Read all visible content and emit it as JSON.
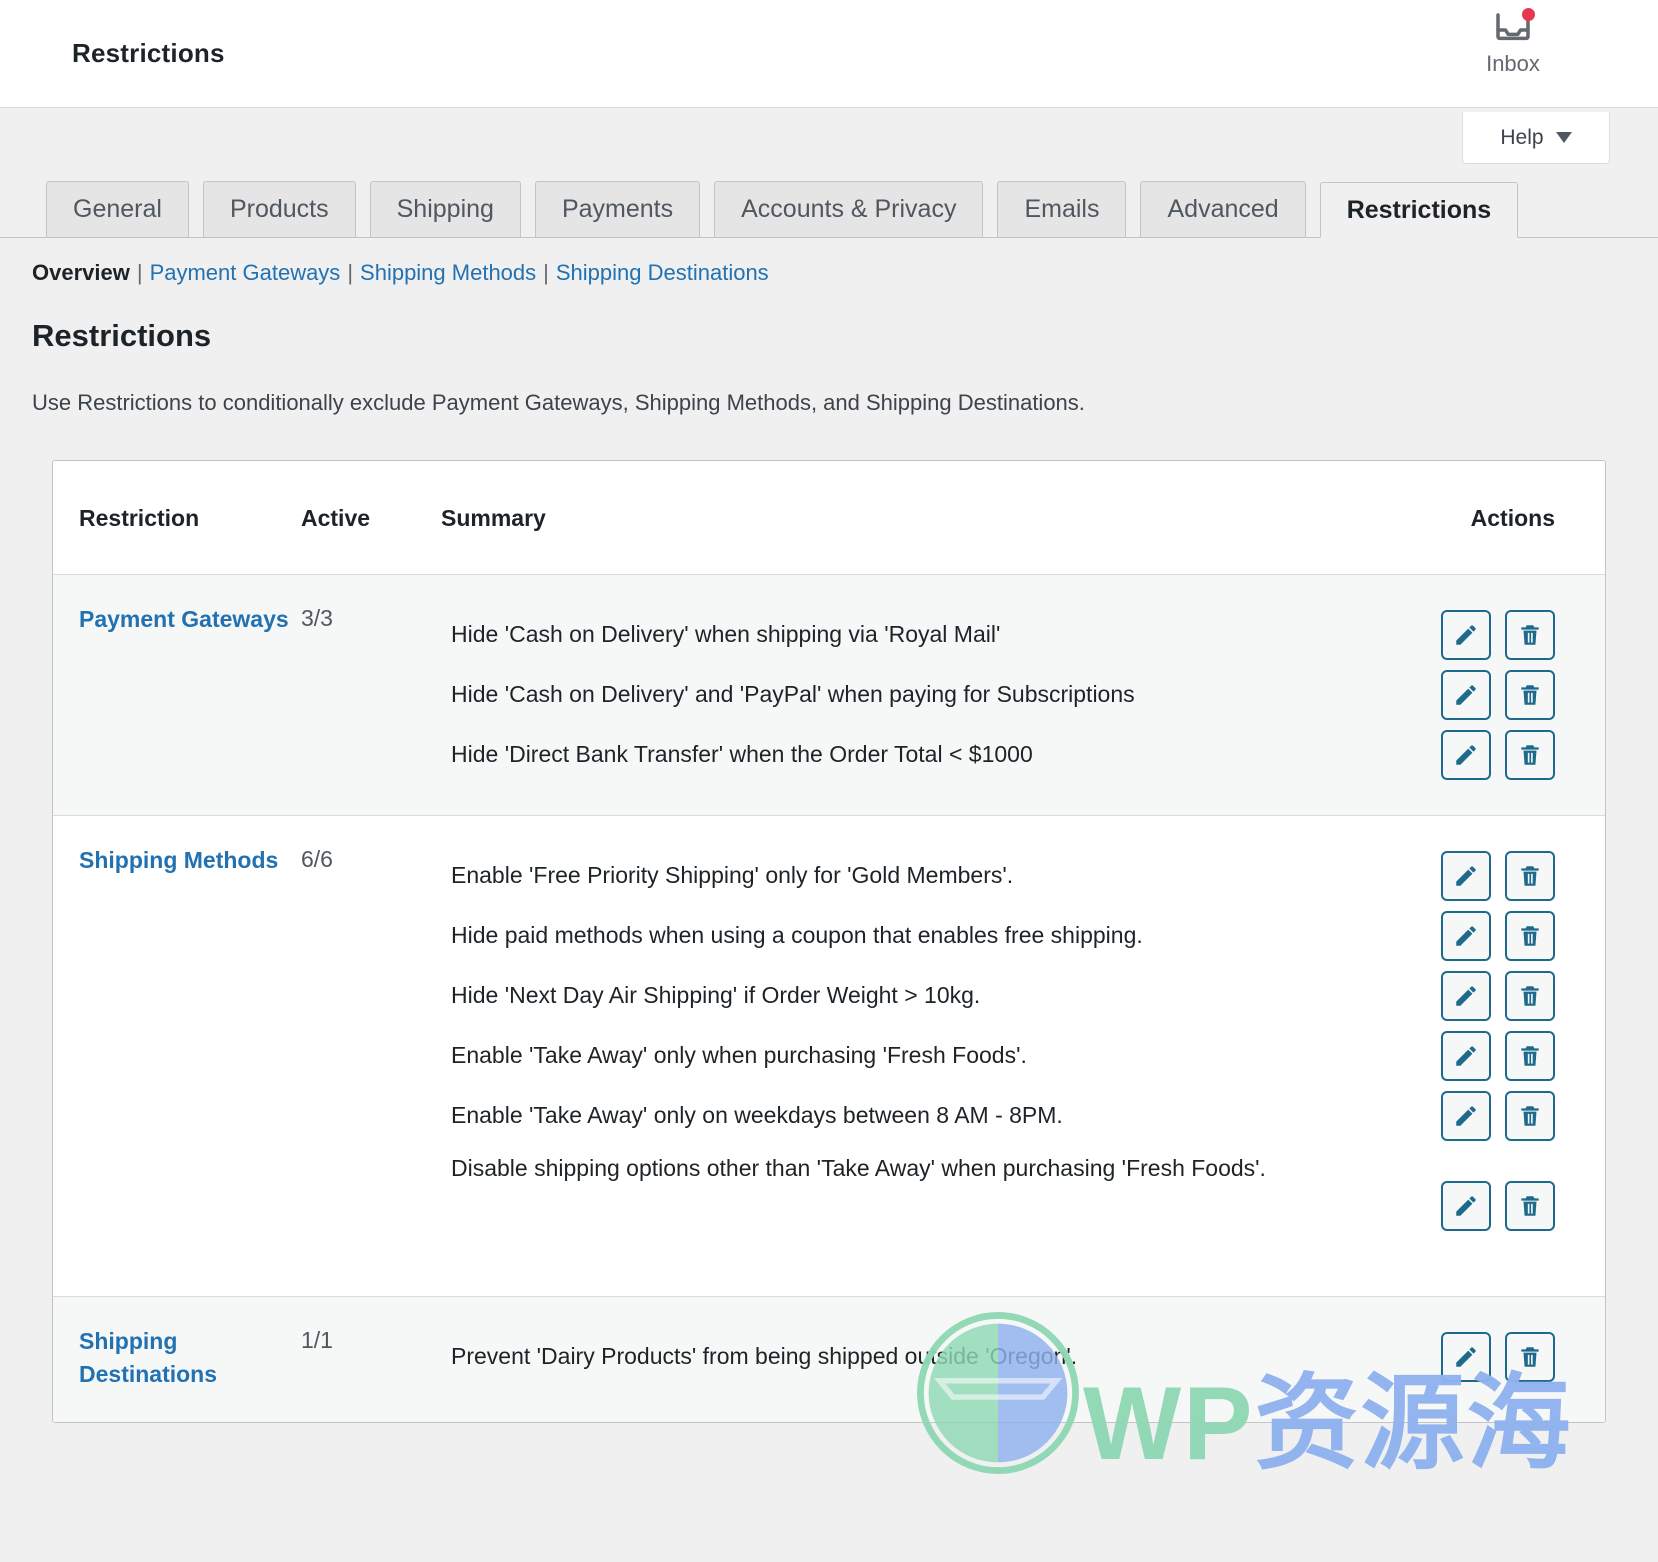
{
  "topbar": {
    "title": "Restrictions",
    "inbox_label": "Inbox",
    "inbox_icon": "inbox-tray-icon",
    "notification_dot_color": "#e8384f"
  },
  "help": {
    "label": "Help",
    "caret_icon": "chevron-down-icon"
  },
  "tabs": [
    {
      "label": "General",
      "active": false
    },
    {
      "label": "Products",
      "active": false
    },
    {
      "label": "Shipping",
      "active": false
    },
    {
      "label": "Payments",
      "active": false
    },
    {
      "label": "Accounts & Privacy",
      "active": false
    },
    {
      "label": "Emails",
      "active": false
    },
    {
      "label": "Advanced",
      "active": false
    },
    {
      "label": "Restrictions",
      "active": true
    }
  ],
  "subnav": {
    "current": "Overview",
    "links": [
      "Payment Gateways",
      "Shipping Methods",
      "Shipping Destinations"
    ],
    "separator": "|"
  },
  "page": {
    "heading": "Restrictions",
    "description": "Use Restrictions to conditionally exclude Payment Gateways, Shipping Methods, and Shipping Destinations."
  },
  "table": {
    "columns": {
      "restriction": "Restriction",
      "active": "Active",
      "summary": "Summary",
      "actions": "Actions"
    },
    "rows": [
      {
        "restriction": "Payment Gateways",
        "active": "3/3",
        "summaries": [
          "Hide 'Cash on Delivery' when shipping via 'Royal Mail'",
          "Hide 'Cash on Delivery' and 'PayPal' when paying for Subscriptions",
          "Hide 'Direct Bank Transfer' when the Order Total < $1000"
        ]
      },
      {
        "restriction": "Shipping Methods",
        "active": "6/6",
        "summaries": [
          "Enable 'Free Priority Shipping' only for 'Gold Members'.",
          "Hide paid methods when using a coupon that enables free shipping.",
          "Hide 'Next Day Air Shipping' if Order Weight > 10kg.",
          "Enable 'Take Away' only when purchasing 'Fresh Foods'.",
          "Enable 'Take Away' only on weekdays between 8 AM - 8PM.",
          "Disable shipping options other than 'Take Away' when purchasing 'Fresh Foods'."
        ]
      },
      {
        "restriction": "Shipping Destinations",
        "active": "1/1",
        "summaries": [
          "Prevent 'Dairy Products' from being shipped outside 'Oregon'."
        ]
      }
    ],
    "action_icons": {
      "edit": "pencil-icon",
      "delete": "trash-icon"
    },
    "action_color": "#1d6a8c"
  },
  "watermark": {
    "brand_latin": "WP",
    "brand_cjk": "资源海",
    "logo_icon": "wordpress-logo-icon"
  }
}
